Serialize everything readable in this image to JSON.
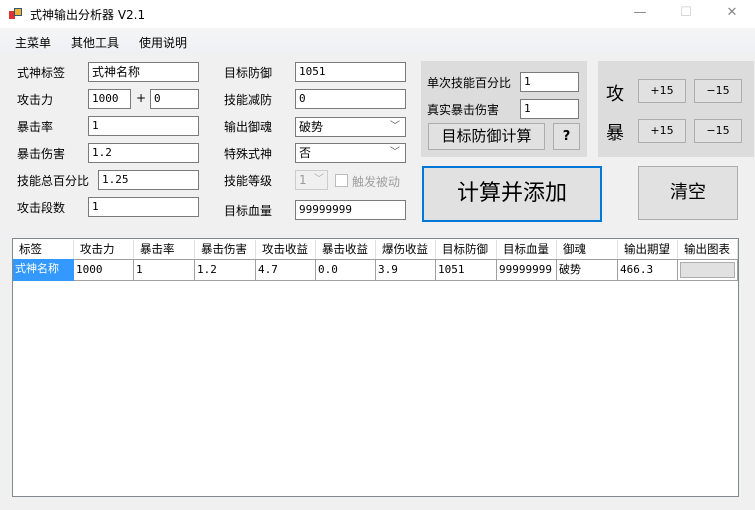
{
  "window": {
    "title": "式神输出分析器 V2.1",
    "minimize": "—",
    "maximize": "☐",
    "close": "✕"
  },
  "menu": [
    "主菜单",
    "其他工具",
    "使用说明"
  ],
  "form": {
    "shikigami_label": {
      "label": "式神标签",
      "value": "式神名称"
    },
    "attack": {
      "label": "攻击力",
      "value": "1000",
      "plus": "+",
      "bonus": "0"
    },
    "crit_rate": {
      "label": "暴击率",
      "value": "1"
    },
    "crit_damage": {
      "label": "暴击伤害",
      "value": "1.2"
    },
    "skill_percent": {
      "label": "技能总百分比",
      "value": "1.25"
    },
    "hit_count": {
      "label": "攻击段数",
      "value": "1"
    },
    "target_defense": {
      "label": "目标防御",
      "value": "1051"
    },
    "skill_def_reduce": {
      "label": "技能减防",
      "value": "0"
    },
    "soul": {
      "label": "输出御魂",
      "value": "破势"
    },
    "special": {
      "label": "特殊式神",
      "value": "否"
    },
    "skill_level": {
      "label": "技能等级",
      "value": "1"
    },
    "trigger_passive": {
      "label": "触发被动",
      "checked": false
    },
    "target_hp": {
      "label": "目标血量",
      "value": "99999999"
    }
  },
  "defense_panel": {
    "single_skill_label": "单次技能百分比",
    "single_skill_value": "1",
    "true_crit_label": "真实暴击伤害",
    "true_crit_value": "1",
    "calc_button": "目标防御计算",
    "help_button": "?"
  },
  "adjust_panel": {
    "atk_label": "攻",
    "crit_label": "暴",
    "plus": "+15",
    "minus": "−15"
  },
  "actions": {
    "calculate": "计算并添加",
    "clear": "清空"
  },
  "table": {
    "headers": [
      "标签",
      "攻击力",
      "暴击率",
      "暴击伤害",
      "攻击收益",
      "暴击收益",
      "爆伤收益",
      "目标防御",
      "目标血量",
      "御魂",
      "输出期望",
      "输出图表"
    ],
    "rows": [
      [
        "式神名称",
        "1000",
        "1",
        "1.2",
        "4.7",
        "0.0",
        "3.9",
        "1051",
        "99999999",
        "破势",
        "466.3",
        ""
      ]
    ]
  },
  "colors": {
    "selection": "#3399ff",
    "focus_border": "#0078d7"
  }
}
